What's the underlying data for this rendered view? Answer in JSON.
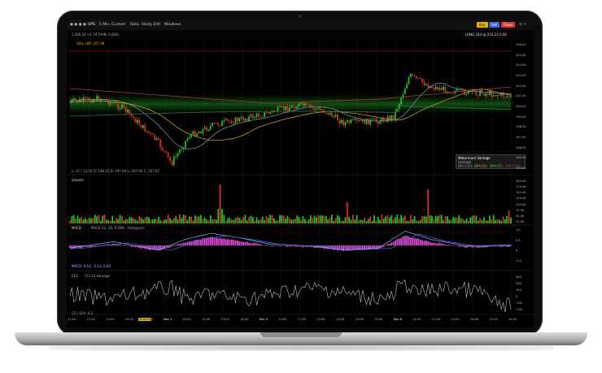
{
  "toolbar": {
    "symbol": "UPS",
    "interval": "5 Min. Custom",
    "menu": [
      "Data",
      "Study Edit",
      "Windows"
    ],
    "quote": "1,200.24 +1.74 GAIN, 0.00%",
    "pills": [
      "Buy",
      "Sell",
      "Close"
    ],
    "pill_colors": [
      "#e8b400",
      "#3b66d9",
      "#d23a3a"
    ],
    "right_text": "LONG 244 @ 201.22 0.00",
    "order_line": "SELL LMT 207.39"
  },
  "price_panel": {
    "ohlc": "L: 12 / 13:10   O: 198.15   H: 197.64   L: 197.64   C: 197.87",
    "y_ticks": [
      "206.00",
      "205.00",
      "204.00",
      "203.00",
      "202.00",
      "201.00",
      "200.00",
      "199.00",
      "198.00",
      "197.00",
      "196.00",
      "195.00",
      "194.00"
    ],
    "legend_title": "Watermark Vantage",
    "legend_sub": "Vantage",
    "legend_items": [
      "BPA(100)",
      "BPA(20)",
      "BPA(55)",
      "BPA(200)"
    ]
  },
  "volume_panel": {
    "title": "Volume",
    "y_ticks": [
      "200.0K",
      "175.0K",
      "150.0K",
      "125.0K",
      "100.0K",
      "75.0K",
      "50.0K",
      "25.0K"
    ]
  },
  "macd_panel": {
    "title": "MACD",
    "legend": "MACD  12, 26, 9 EMA  ·  Histogram",
    "footer": "MACD  -0.14, -0.13, 0.04",
    "y_ticks": [
      "1.0",
      "0.5",
      "0",
      "-0.5"
    ]
  },
  "cci_panel": {
    "title": "CCI",
    "legend": "CCI  14 Vantage",
    "footer": "CCI  -104  -0.2",
    "y_ticks": [
      "300",
      "200",
      "100",
      "0",
      "-100",
      "-200"
    ]
  },
  "x_axis": {
    "labels": [
      "11:00",
      "12:00",
      "13:00",
      "14:00",
      "15:00",
      "Dec 3",
      "10:00",
      "12:00",
      "13:00",
      "14:00",
      "Dec 5",
      "10:00",
      "11:00",
      "12:00",
      "13:00",
      "14:00",
      "15:00",
      "Dec 6",
      "11:00",
      "12:00",
      "13:00",
      "14:00",
      "15:00",
      "16:00"
    ],
    "highlight": "14:00:00"
  },
  "colors": {
    "up": "#1fbf2f",
    "down": "#e02a2a",
    "ma_fast": "#6d8fa8",
    "ma_slow": "#c49a2a",
    "ma_long": "#a23a3a",
    "macd_hist": "#e24ad9",
    "cci": "#bfbfbf"
  }
}
